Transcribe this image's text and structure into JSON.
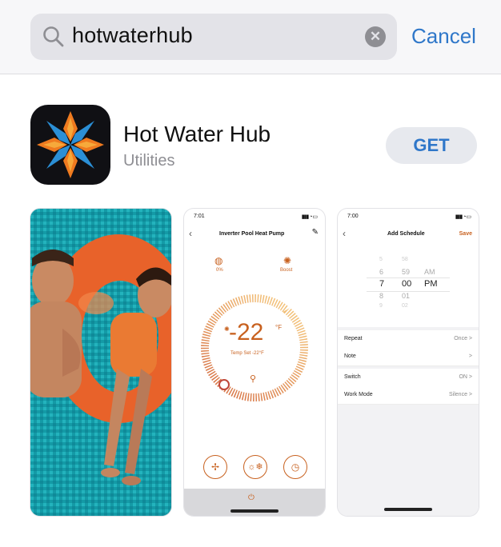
{
  "search": {
    "query": "hotwaterhub",
    "cancel_label": "Cancel"
  },
  "app": {
    "name": "Hot Water Hub",
    "category": "Utilities",
    "get_label": "GET"
  },
  "screenshots": {
    "heat_pump": {
      "status_time": "7:01",
      "title": "Inverter Pool Heat Pump",
      "left_value": "0%",
      "right_label": "Boost",
      "temperature": "-22",
      "temp_unit": "°F",
      "temp_set": "Temp Set  -22°F"
    },
    "schedule": {
      "status_time": "7:00",
      "title": "Add Schedule",
      "save_label": "Save",
      "picker": {
        "hours": [
          "5",
          "6",
          "7",
          "8",
          "9"
        ],
        "minutes": [
          "58",
          "59",
          "00",
          "01",
          "02"
        ],
        "periods": [
          "AM",
          "PM"
        ]
      },
      "rows": [
        {
          "label": "Repeat",
          "value": "Once >"
        },
        {
          "label": "Note",
          "value": ">"
        },
        {
          "label": "Switch",
          "value": "ON >"
        },
        {
          "label": "Work Mode",
          "value": "Silence >"
        }
      ]
    }
  },
  "colors": {
    "accent_blue": "#2f77c9",
    "app_orange": "#e8661c",
    "heat_orange": "#c8611f"
  }
}
